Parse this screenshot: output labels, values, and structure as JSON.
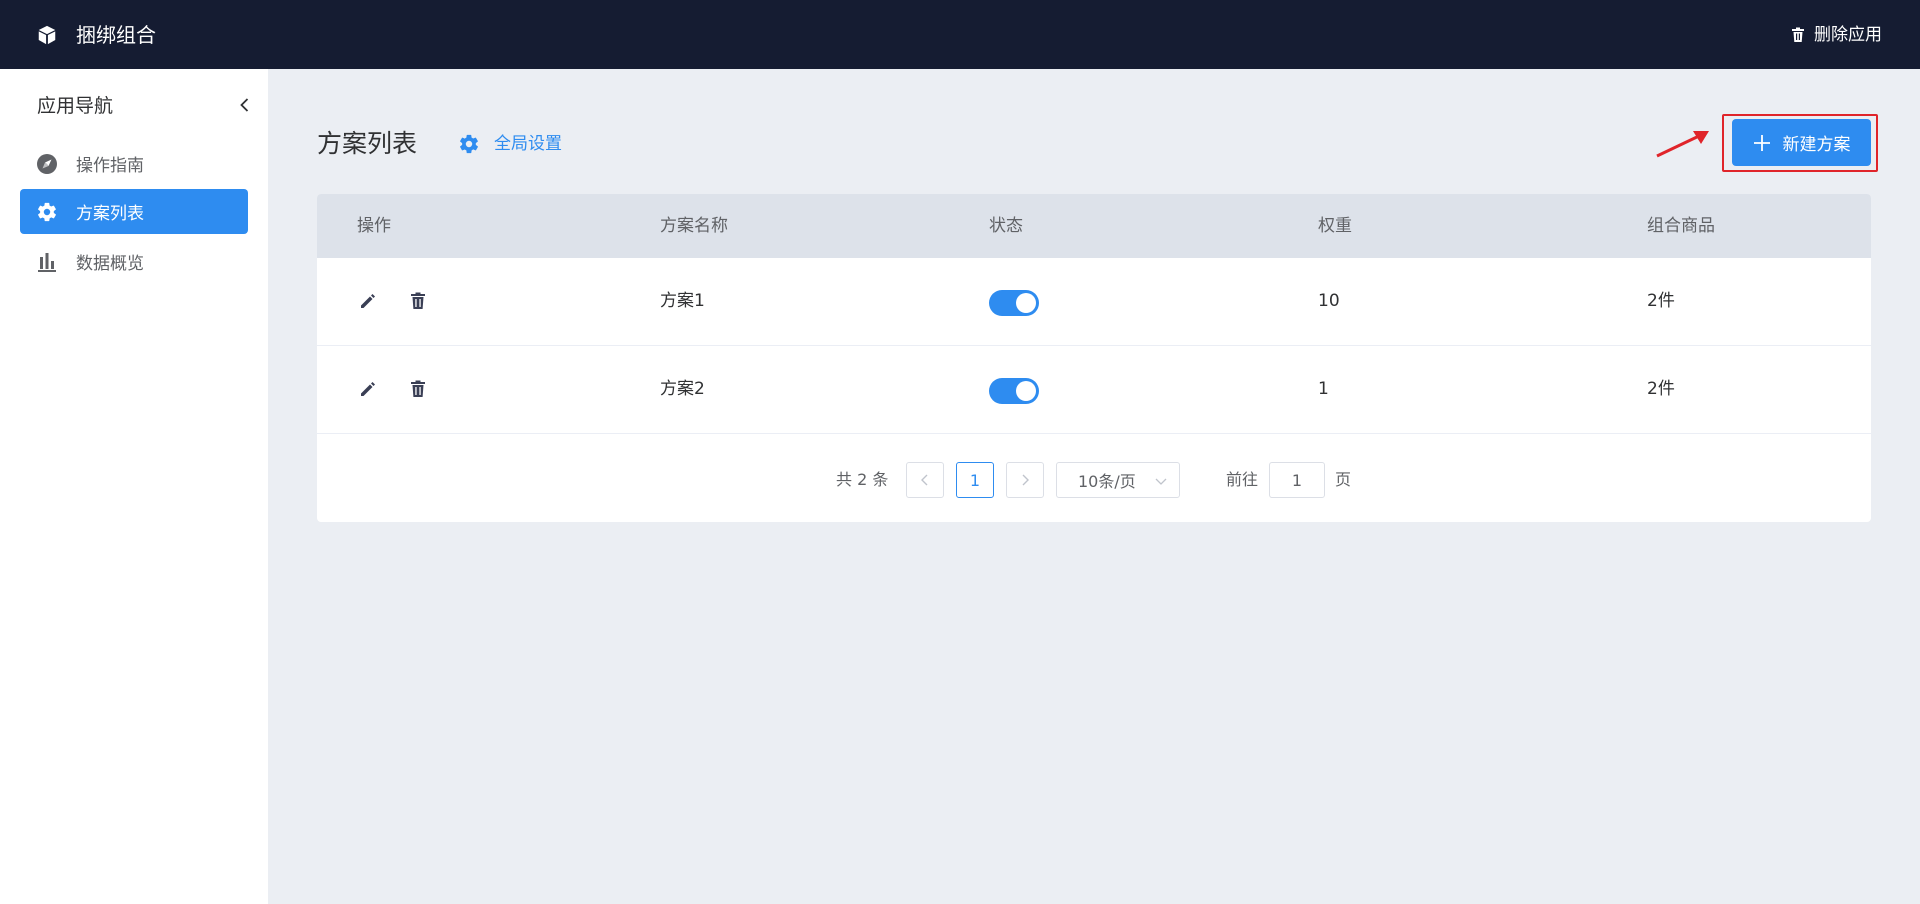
{
  "topbar": {
    "app_title": "捆绑组合",
    "delete_label": "删除应用"
  },
  "sidebar": {
    "title": "应用导航",
    "items": [
      {
        "label": "操作指南",
        "icon": "compass-icon",
        "active": false
      },
      {
        "label": "方案列表",
        "icon": "gear-icon",
        "active": true
      },
      {
        "label": "数据概览",
        "icon": "bar-chart-icon",
        "active": false
      }
    ]
  },
  "main": {
    "title": "方案列表",
    "global_settings_label": "全局设置",
    "new_plan_label": "新建方案",
    "accent_color": "#2e8cf0",
    "highlight_color": "#e0242a"
  },
  "table": {
    "headers": [
      "操作",
      "方案名称",
      "状态",
      "权重",
      "组合商品"
    ],
    "rows": [
      {
        "name": "方案1",
        "status_on": true,
        "weight": "10",
        "items": "2件"
      },
      {
        "name": "方案2",
        "status_on": true,
        "weight": "1",
        "items": "2件"
      }
    ]
  },
  "pagination": {
    "total_text": "共 2 条",
    "current_page": "1",
    "page_size": "10条/页",
    "goto_label": "前往",
    "goto_value": "1",
    "page_suffix": "页"
  }
}
